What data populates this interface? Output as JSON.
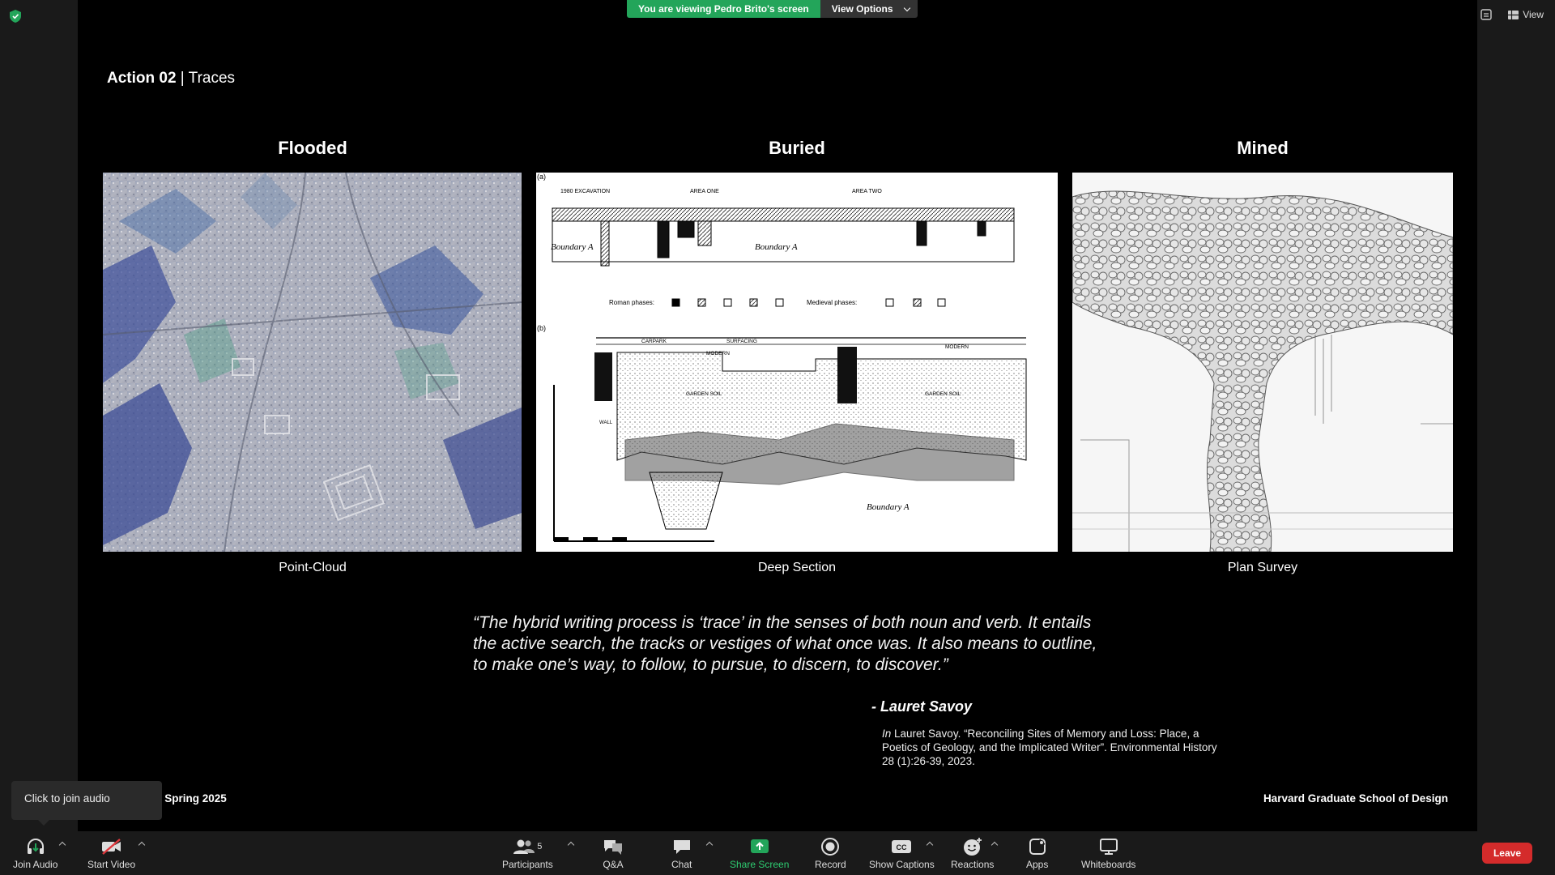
{
  "banner": {
    "message": "You are viewing Pedro Brito's screen",
    "view_options": "View Options"
  },
  "top_right": {
    "view_label": "View"
  },
  "slide": {
    "title_bold": "Action 02",
    "title_rest": " | Traces",
    "columns": [
      {
        "heading": "Flooded",
        "caption": "Point-Cloud"
      },
      {
        "heading": "Buried",
        "caption": "Deep Section"
      },
      {
        "heading": "Mined",
        "caption": "Plan Survey"
      }
    ],
    "quote": "“The hybrid writing process is ‘trace’ in the senses of both noun and verb. It entails the active search, the tracks or vestiges of what once was. It also means to outline, to make one’s way, to follow, to pursue, to discern, to discover.”",
    "author": "- Lauret Savoy",
    "cite_in": "In",
    "cite_text": " Lauret Savoy. “Reconciling Sites of Memory and Loss: Place, a Poetics of Geology, and the Implicated Writer”. Environmental History 28 (1):26-39, 2023.",
    "footer_left": "esis _ Spring 2025",
    "footer_right": "Harvard Graduate School of Design",
    "section": {
      "labels": [
        "Boundary A",
        "Boundary A",
        "Boundary A"
      ],
      "roman_phases": "Roman phases:",
      "medieval_phases": "Medieval phases:",
      "tag_a": "(a)",
      "tag_b": "(b)",
      "area_one": "AREA ONE",
      "area_two": "AREA TWO",
      "excavation": "1980 EXCAVATION",
      "carpark": "CARPARK",
      "surfacing": "SURFACING",
      "modern": "MODERN",
      "garden_soil": "GARDEN SOIL",
      "wall": "WALL"
    }
  },
  "tooltip": {
    "text": "Click to join audio"
  },
  "toolbar": {
    "join_audio": "Join Audio",
    "start_video": "Start Video",
    "participants": "Participants",
    "participants_count": "5",
    "qa": "Q&A",
    "chat": "Chat",
    "share_screen": "Share Screen",
    "record": "Record",
    "show_captions": "Show Captions",
    "reactions": "Reactions",
    "apps": "Apps",
    "whiteboards": "Whiteboards",
    "leave": "Leave"
  },
  "colors": {
    "share_green": "#23a55a",
    "leave_red": "#d42b2b"
  }
}
